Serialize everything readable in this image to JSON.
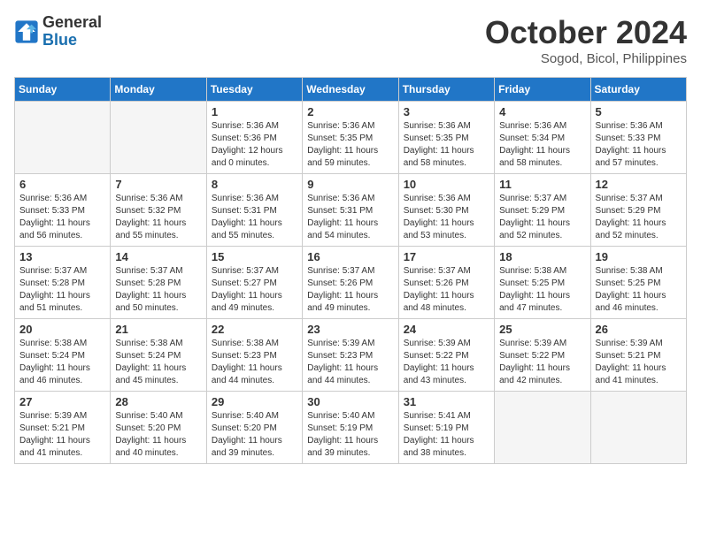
{
  "header": {
    "logo_text_general": "General",
    "logo_text_blue": "Blue",
    "month": "October 2024",
    "location": "Sogod, Bicol, Philippines"
  },
  "columns": [
    "Sunday",
    "Monday",
    "Tuesday",
    "Wednesday",
    "Thursday",
    "Friday",
    "Saturday"
  ],
  "weeks": [
    [
      {
        "day": "",
        "empty": true
      },
      {
        "day": "",
        "empty": true
      },
      {
        "day": "1",
        "sunrise": "Sunrise: 5:36 AM",
        "sunset": "Sunset: 5:36 PM",
        "daylight": "Daylight: 12 hours and 0 minutes."
      },
      {
        "day": "2",
        "sunrise": "Sunrise: 5:36 AM",
        "sunset": "Sunset: 5:35 PM",
        "daylight": "Daylight: 11 hours and 59 minutes."
      },
      {
        "day": "3",
        "sunrise": "Sunrise: 5:36 AM",
        "sunset": "Sunset: 5:35 PM",
        "daylight": "Daylight: 11 hours and 58 minutes."
      },
      {
        "day": "4",
        "sunrise": "Sunrise: 5:36 AM",
        "sunset": "Sunset: 5:34 PM",
        "daylight": "Daylight: 11 hours and 58 minutes."
      },
      {
        "day": "5",
        "sunrise": "Sunrise: 5:36 AM",
        "sunset": "Sunset: 5:33 PM",
        "daylight": "Daylight: 11 hours and 57 minutes."
      }
    ],
    [
      {
        "day": "6",
        "sunrise": "Sunrise: 5:36 AM",
        "sunset": "Sunset: 5:33 PM",
        "daylight": "Daylight: 11 hours and 56 minutes."
      },
      {
        "day": "7",
        "sunrise": "Sunrise: 5:36 AM",
        "sunset": "Sunset: 5:32 PM",
        "daylight": "Daylight: 11 hours and 55 minutes."
      },
      {
        "day": "8",
        "sunrise": "Sunrise: 5:36 AM",
        "sunset": "Sunset: 5:31 PM",
        "daylight": "Daylight: 11 hours and 55 minutes."
      },
      {
        "day": "9",
        "sunrise": "Sunrise: 5:36 AM",
        "sunset": "Sunset: 5:31 PM",
        "daylight": "Daylight: 11 hours and 54 minutes."
      },
      {
        "day": "10",
        "sunrise": "Sunrise: 5:36 AM",
        "sunset": "Sunset: 5:30 PM",
        "daylight": "Daylight: 11 hours and 53 minutes."
      },
      {
        "day": "11",
        "sunrise": "Sunrise: 5:37 AM",
        "sunset": "Sunset: 5:29 PM",
        "daylight": "Daylight: 11 hours and 52 minutes."
      },
      {
        "day": "12",
        "sunrise": "Sunrise: 5:37 AM",
        "sunset": "Sunset: 5:29 PM",
        "daylight": "Daylight: 11 hours and 52 minutes."
      }
    ],
    [
      {
        "day": "13",
        "sunrise": "Sunrise: 5:37 AM",
        "sunset": "Sunset: 5:28 PM",
        "daylight": "Daylight: 11 hours and 51 minutes."
      },
      {
        "day": "14",
        "sunrise": "Sunrise: 5:37 AM",
        "sunset": "Sunset: 5:28 PM",
        "daylight": "Daylight: 11 hours and 50 minutes."
      },
      {
        "day": "15",
        "sunrise": "Sunrise: 5:37 AM",
        "sunset": "Sunset: 5:27 PM",
        "daylight": "Daylight: 11 hours and 49 minutes."
      },
      {
        "day": "16",
        "sunrise": "Sunrise: 5:37 AM",
        "sunset": "Sunset: 5:26 PM",
        "daylight": "Daylight: 11 hours and 49 minutes."
      },
      {
        "day": "17",
        "sunrise": "Sunrise: 5:37 AM",
        "sunset": "Sunset: 5:26 PM",
        "daylight": "Daylight: 11 hours and 48 minutes."
      },
      {
        "day": "18",
        "sunrise": "Sunrise: 5:38 AM",
        "sunset": "Sunset: 5:25 PM",
        "daylight": "Daylight: 11 hours and 47 minutes."
      },
      {
        "day": "19",
        "sunrise": "Sunrise: 5:38 AM",
        "sunset": "Sunset: 5:25 PM",
        "daylight": "Daylight: 11 hours and 46 minutes."
      }
    ],
    [
      {
        "day": "20",
        "sunrise": "Sunrise: 5:38 AM",
        "sunset": "Sunset: 5:24 PM",
        "daylight": "Daylight: 11 hours and 46 minutes."
      },
      {
        "day": "21",
        "sunrise": "Sunrise: 5:38 AM",
        "sunset": "Sunset: 5:24 PM",
        "daylight": "Daylight: 11 hours and 45 minutes."
      },
      {
        "day": "22",
        "sunrise": "Sunrise: 5:38 AM",
        "sunset": "Sunset: 5:23 PM",
        "daylight": "Daylight: 11 hours and 44 minutes."
      },
      {
        "day": "23",
        "sunrise": "Sunrise: 5:39 AM",
        "sunset": "Sunset: 5:23 PM",
        "daylight": "Daylight: 11 hours and 44 minutes."
      },
      {
        "day": "24",
        "sunrise": "Sunrise: 5:39 AM",
        "sunset": "Sunset: 5:22 PM",
        "daylight": "Daylight: 11 hours and 43 minutes."
      },
      {
        "day": "25",
        "sunrise": "Sunrise: 5:39 AM",
        "sunset": "Sunset: 5:22 PM",
        "daylight": "Daylight: 11 hours and 42 minutes."
      },
      {
        "day": "26",
        "sunrise": "Sunrise: 5:39 AM",
        "sunset": "Sunset: 5:21 PM",
        "daylight": "Daylight: 11 hours and 41 minutes."
      }
    ],
    [
      {
        "day": "27",
        "sunrise": "Sunrise: 5:39 AM",
        "sunset": "Sunset: 5:21 PM",
        "daylight": "Daylight: 11 hours and 41 minutes."
      },
      {
        "day": "28",
        "sunrise": "Sunrise: 5:40 AM",
        "sunset": "Sunset: 5:20 PM",
        "daylight": "Daylight: 11 hours and 40 minutes."
      },
      {
        "day": "29",
        "sunrise": "Sunrise: 5:40 AM",
        "sunset": "Sunset: 5:20 PM",
        "daylight": "Daylight: 11 hours and 39 minutes."
      },
      {
        "day": "30",
        "sunrise": "Sunrise: 5:40 AM",
        "sunset": "Sunset: 5:19 PM",
        "daylight": "Daylight: 11 hours and 39 minutes."
      },
      {
        "day": "31",
        "sunrise": "Sunrise: 5:41 AM",
        "sunset": "Sunset: 5:19 PM",
        "daylight": "Daylight: 11 hours and 38 minutes."
      },
      {
        "day": "",
        "empty": true
      },
      {
        "day": "",
        "empty": true
      }
    ]
  ]
}
